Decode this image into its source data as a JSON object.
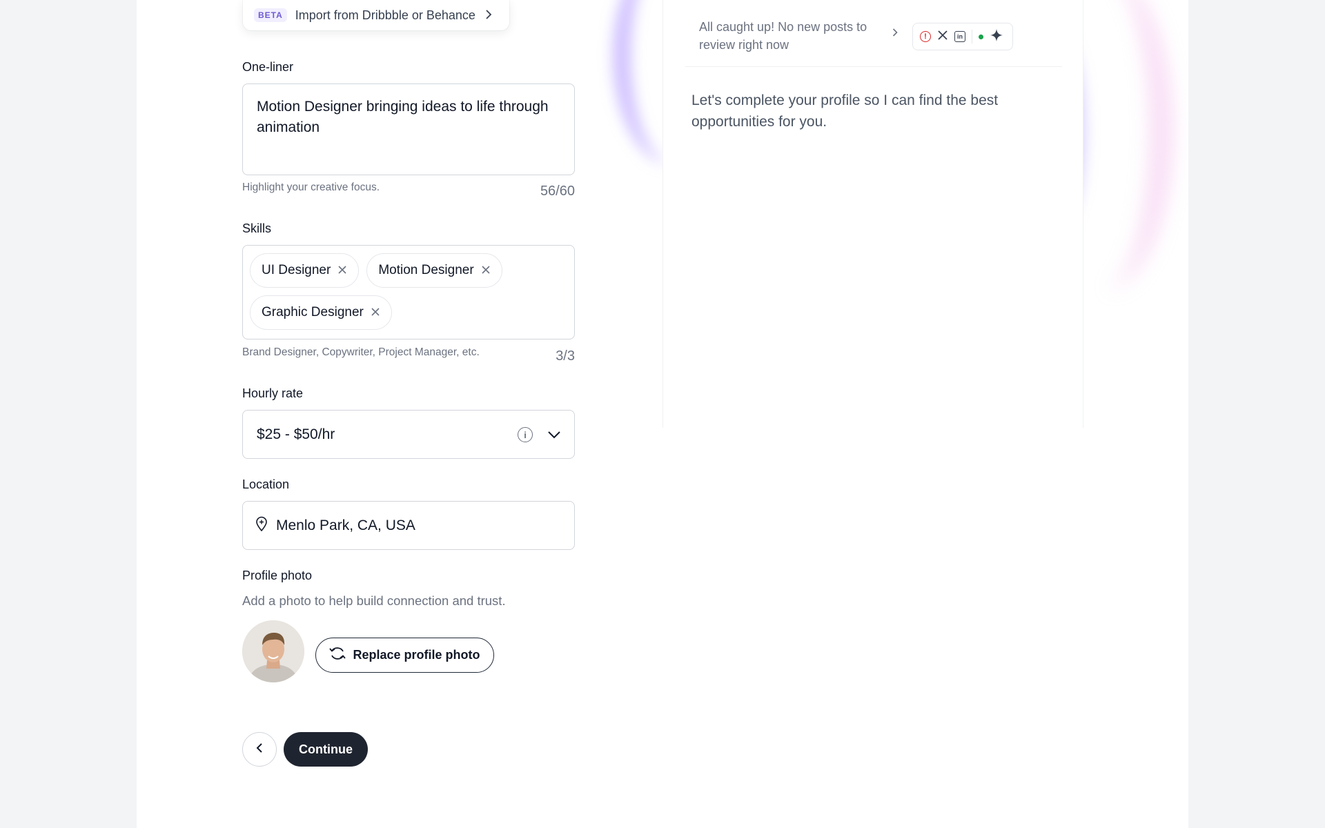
{
  "import": {
    "badge": "BETA",
    "label": "Import from Dribbble or Behance"
  },
  "one_liner": {
    "label": "One-liner",
    "value": "Motion Designer bringing ideas to life through animation",
    "hint": "Highlight your creative focus.",
    "counter": "56/60"
  },
  "skills": {
    "label": "Skills",
    "chips": [
      "UI Designer",
      "Motion Designer",
      "Graphic Designer"
    ],
    "hint": "Brand Designer, Copywriter, Project Manager, etc.",
    "counter": "3/3"
  },
  "hourly_rate": {
    "label": "Hourly rate",
    "value": "$25 - $50/hr"
  },
  "location": {
    "label": "Location",
    "value": "Menlo Park, CA, USA"
  },
  "profile_photo": {
    "label": "Profile photo",
    "hint": "Add a photo to help build connection and trust.",
    "replace_label": "Replace profile photo"
  },
  "nav": {
    "continue_label": "Continue"
  },
  "panel": {
    "status": "All caught up! No new posts to review right now",
    "message": "Let's complete your profile so I can find the best opportunities for you.",
    "icons": [
      "alert-icon",
      "x-logo-icon",
      "linkedin-icon",
      "status-dot",
      "sparkle-icon"
    ]
  },
  "colors": {
    "primary_button": "#1f2530",
    "beta_badge": "#6d5bd0",
    "status_dot": "#16a34a",
    "alert": "#dc2626"
  }
}
